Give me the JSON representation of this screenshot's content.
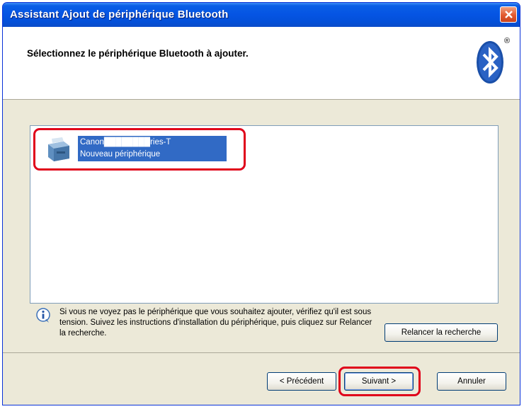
{
  "window": {
    "title": "Assistant Ajout de périphérique Bluetooth"
  },
  "header": {
    "title": "Sélectionnez le périphérique Bluetooth à ajouter.",
    "logo_icon": "bluetooth-icon",
    "registered_mark": "®"
  },
  "device_list": {
    "items": [
      {
        "name": "Canon████████ries-T",
        "subtitle": "Nouveau périphérique",
        "icon": "printer-icon",
        "selected": true
      }
    ]
  },
  "info": {
    "icon": "info-icon",
    "text": "Si vous ne voyez pas le périphérique que vous souhaitez ajouter, vérifiez qu'il est sous tension. Suivez les instructions d'installation du périphérique, puis cliquez sur Relancer la recherche."
  },
  "buttons": {
    "search_again": "Relancer la recherche",
    "back": "< Précédent",
    "next": "Suivant >",
    "cancel": "Annuler"
  },
  "colors": {
    "titlebar": "#0554e3",
    "selection": "#316ac5",
    "highlight_outline": "#e0001a",
    "dialog_background": "#ece9d8"
  }
}
